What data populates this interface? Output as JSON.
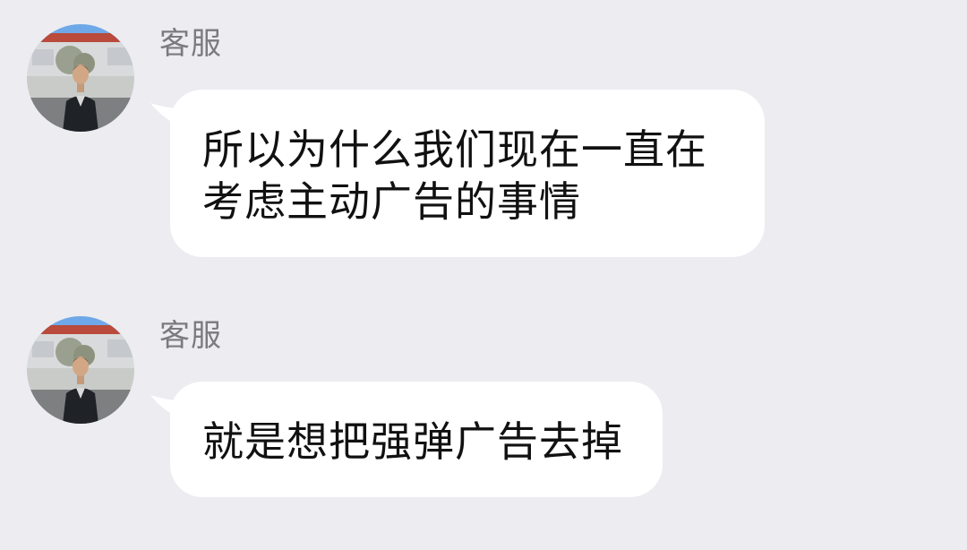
{
  "messages": [
    {
      "sender": "客服",
      "lines": [
        "所以为什么我们现在一直在",
        "考虑主动广告的事情"
      ]
    },
    {
      "sender": "客服",
      "lines": [
        "就是想把强弹广告去掉"
      ]
    }
  ],
  "colors": {
    "background": "#ececf1",
    "bubble": "#ffffff",
    "sender_text": "#7a7a80",
    "message_text": "#111111"
  }
}
